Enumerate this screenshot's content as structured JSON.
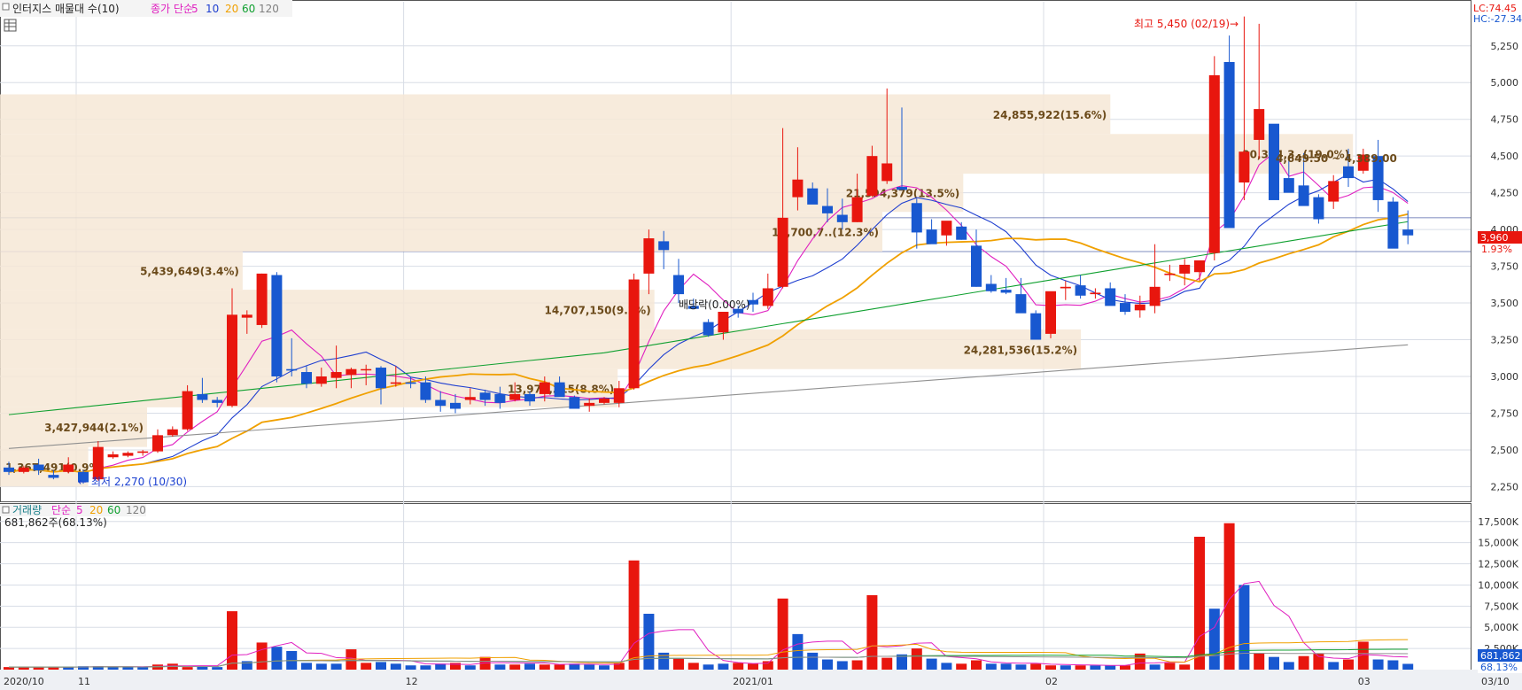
{
  "legend": {
    "title": "인터지스 매물대 수(10)",
    "ma_label": "종가 단순",
    "ma_periods": [
      "5",
      "10",
      "20",
      "60",
      "120"
    ],
    "ma_colors": [
      "#e020c0",
      "#1f3fd0",
      "#f0a000",
      "#10a030",
      "#909090"
    ]
  },
  "top_right": {
    "lc": "LC:74.45",
    "hc": "HC:-27.34"
  },
  "price_tag": {
    "value": "3,960",
    "change": "1.93%"
  },
  "annotations": {
    "high": "최고 5,450 (02/19)",
    "low": "최저 2,270 (10/30)",
    "dividend": "배당락(0.00%)"
  },
  "volume_legend": {
    "title": "거래량",
    "ma_label": "단순",
    "ma_periods": [
      "5",
      "20",
      "60",
      "120"
    ],
    "last": "681,862주(68.13%)"
  },
  "volume_tag": {
    "value": "681,862",
    "pct": "68.13%"
  },
  "colors": {
    "up": "#e8160e",
    "down": "#1858d0",
    "zone": "#f6e8d6",
    "zone_text": "#6b4a1a",
    "axis": "#303030",
    "grid": "#d8dde6"
  },
  "chart_data": {
    "type": "candlestick",
    "y_ticks": [
      2250,
      2500,
      2750,
      3000,
      3250,
      3500,
      3750,
      4000,
      4250,
      4500,
      4750,
      5000,
      5250
    ],
    "ylim": [
      2150,
      5550
    ],
    "x_labels": [
      "2020/10",
      "11",
      "12",
      "2021/01",
      "02",
      "03",
      "03/10"
    ],
    "volume_ticks": [
      "2,500K",
      "5,000K",
      "7,500K",
      "10,000K",
      "12,500K",
      "15,000K",
      "17,500K"
    ],
    "volume_ylim": [
      0,
      18000
    ],
    "volume_profile": [
      {
        "low": 2250,
        "high": 2520,
        "label": "1,367,491(0.9%)",
        "width": 0.06
      },
      {
        "low": 2520,
        "high": 2790,
        "label": "3,427,944(2.1%)",
        "width": 0.1
      },
      {
        "low": 2790,
        "high": 3050,
        "label": "13,979,215(8.8%)",
        "width": 0.42
      },
      {
        "low": 3050,
        "high": 3320,
        "label": "24,281,536(15.2%)",
        "width": 0.735
      },
      {
        "low": 3320,
        "high": 3590,
        "label": "14,707,150(9.2%)",
        "width": 0.445
      },
      {
        "low": 3590,
        "high": 3850,
        "label": "5,439,649(3.4%)",
        "width": 0.165
      },
      {
        "low": 3850,
        "high": 4120,
        "label": "19,700,7..(12.3%)",
        "width": 0.6
      },
      {
        "low": 4120,
        "high": 4380,
        "label": "21,594,379(13.5%)",
        "width": 0.655
      },
      {
        "low": 4380,
        "high": 4650,
        "label": "30,304,3..(19.0%)",
        "width": 0.92
      },
      {
        "low": 4650,
        "high": 4920,
        "label": "24,855,922(15.6%)",
        "width": 0.755
      }
    ],
    "range_label": "4,649.50 ~ 4,389.00",
    "ohlc": [
      [
        2380,
        2420,
        2330,
        2350
      ],
      [
        2350,
        2390,
        2340,
        2380
      ],
      [
        2400,
        2440,
        2330,
        2360
      ],
      [
        2330,
        2360,
        2300,
        2310
      ],
      [
        2350,
        2450,
        2340,
        2400
      ],
      [
        2350,
        2360,
        2270,
        2280
      ],
      [
        2300,
        2560,
        2290,
        2520
      ],
      [
        2450,
        2490,
        2440,
        2470
      ],
      [
        2460,
        2490,
        2450,
        2480
      ],
      [
        2480,
        2500,
        2460,
        2490
      ],
      [
        2490,
        2640,
        2480,
        2600
      ],
      [
        2600,
        2660,
        2590,
        2640
      ],
      [
        2640,
        2940,
        2630,
        2900
      ],
      [
        2880,
        2990,
        2820,
        2840
      ],
      [
        2840,
        2860,
        2790,
        2820
      ],
      [
        2800,
        3600,
        2790,
        3420
      ],
      [
        3400,
        3450,
        3290,
        3420
      ],
      [
        3350,
        3700,
        3330,
        3700
      ],
      [
        3690,
        3710,
        2960,
        3000
      ],
      [
        3050,
        3260,
        3000,
        3040
      ],
      [
        3030,
        3070,
        2920,
        2950
      ],
      [
        2950,
        3060,
        2930,
        3000
      ],
      [
        2990,
        3210,
        2920,
        3030
      ],
      [
        3010,
        3060,
        2920,
        3050
      ],
      [
        3050,
        3080,
        2940,
        3050
      ],
      [
        3060,
        3070,
        2810,
        2920
      ],
      [
        2950,
        3070,
        2930,
        2960
      ],
      [
        2960,
        3000,
        2920,
        2950
      ],
      [
        2960,
        3000,
        2820,
        2840
      ],
      [
        2840,
        2900,
        2760,
        2800
      ],
      [
        2820,
        2880,
        2750,
        2780
      ],
      [
        2840,
        2920,
        2810,
        2860
      ],
      [
        2890,
        2910,
        2800,
        2840
      ],
      [
        2880,
        2930,
        2780,
        2820
      ],
      [
        2840,
        2960,
        2830,
        2880
      ],
      [
        2880,
        2900,
        2800,
        2830
      ],
      [
        2880,
        3000,
        2830,
        2960
      ],
      [
        2960,
        3000,
        2870,
        2860
      ],
      [
        2860,
        2870,
        2780,
        2780
      ],
      [
        2800,
        2850,
        2760,
        2820
      ],
      [
        2820,
        2860,
        2810,
        2850
      ],
      [
        2820,
        2970,
        2790,
        2920
      ],
      [
        2920,
        3700,
        2910,
        3660
      ],
      [
        3700,
        4000,
        3560,
        3940
      ],
      [
        3920,
        3990,
        3730,
        3860
      ],
      [
        3690,
        3800,
        3500,
        3560
      ],
      [
        3480,
        3530,
        3470,
        3460
      ],
      [
        3370,
        3390,
        3270,
        3280
      ],
      [
        3300,
        3380,
        3250,
        3440
      ],
      [
        3460,
        3480,
        3400,
        3430
      ],
      [
        3520,
        3570,
        3440,
        3490
      ],
      [
        3480,
        3700,
        3460,
        3600
      ],
      [
        3610,
        4690,
        3600,
        4080
      ],
      [
        4220,
        4560,
        4130,
        4340
      ],
      [
        4280,
        4320,
        4190,
        4170
      ],
      [
        4160,
        4280,
        4050,
        4110
      ],
      [
        4100,
        4210,
        4000,
        4050
      ],
      [
        4050,
        4380,
        4050,
        4220
      ],
      [
        4230,
        4570,
        4220,
        4500
      ],
      [
        4330,
        4960,
        4310,
        4450
      ],
      [
        4290,
        4830,
        4280,
        4270
      ],
      [
        4180,
        4210,
        3870,
        3980
      ],
      [
        4000,
        4070,
        3930,
        3900
      ],
      [
        3960,
        4050,
        3890,
        4060
      ],
      [
        4020,
        4050,
        3930,
        3930
      ],
      [
        3890,
        4000,
        3610,
        3610
      ],
      [
        3630,
        3690,
        3570,
        3580
      ],
      [
        3590,
        3670,
        3560,
        3570
      ],
      [
        3560,
        3670,
        3550,
        3430
      ],
      [
        3430,
        3450,
        3330,
        3250
      ],
      [
        3290,
        3540,
        3260,
        3580
      ],
      [
        3600,
        3650,
        3520,
        3610
      ],
      [
        3620,
        3690,
        3530,
        3550
      ],
      [
        3560,
        3600,
        3530,
        3570
      ],
      [
        3600,
        3640,
        3520,
        3480
      ],
      [
        3500,
        3560,
        3420,
        3440
      ],
      [
        3450,
        3550,
        3400,
        3490
      ],
      [
        3480,
        3900,
        3430,
        3610
      ],
      [
        3690,
        3760,
        3650,
        3700
      ],
      [
        3700,
        3800,
        3620,
        3760
      ],
      [
        3710,
        3760,
        3650,
        3790
      ],
      [
        3840,
        5180,
        3790,
        5050
      ],
      [
        5140,
        5320,
        4120,
        4010
      ],
      [
        4320,
        5450,
        4200,
        4530
      ],
      [
        4610,
        5400,
        4480,
        4820
      ],
      [
        4720,
        4700,
        4290,
        4200
      ],
      [
        4350,
        4480,
        4260,
        4250
      ],
      [
        4300,
        4520,
        4170,
        4160
      ],
      [
        4220,
        4240,
        4040,
        4070
      ],
      [
        4190,
        4370,
        4140,
        4330
      ],
      [
        4430,
        4550,
        4290,
        4350
      ],
      [
        4400,
        4550,
        4380,
        4510
      ],
      [
        4500,
        4610,
        4120,
        4200
      ],
      [
        4190,
        4220,
        3950,
        3870
      ],
      [
        4000,
        4130,
        3900,
        3960
      ]
    ],
    "volume": [
      [
        300,
        1
      ],
      [
        300,
        1
      ],
      [
        300,
        1
      ],
      [
        300,
        1
      ],
      [
        300,
        0
      ],
      [
        400,
        0
      ],
      [
        400,
        0
      ],
      [
        300,
        0
      ],
      [
        300,
        0
      ],
      [
        300,
        0
      ],
      [
        600,
        1
      ],
      [
        700,
        1
      ],
      [
        300,
        1
      ],
      [
        400,
        0
      ],
      [
        300,
        0
      ],
      [
        6900,
        1
      ],
      [
        1000,
        0
      ],
      [
        3200,
        1
      ],
      [
        2700,
        0
      ],
      [
        2200,
        0
      ],
      [
        800,
        0
      ],
      [
        700,
        0
      ],
      [
        700,
        0
      ],
      [
        2400,
        1
      ],
      [
        800,
        1
      ],
      [
        900,
        0
      ],
      [
        700,
        0
      ],
      [
        500,
        0
      ],
      [
        500,
        0
      ],
      [
        700,
        0
      ],
      [
        800,
        1
      ],
      [
        500,
        0
      ],
      [
        1500,
        1
      ],
      [
        600,
        0
      ],
      [
        600,
        1
      ],
      [
        700,
        0
      ],
      [
        600,
        1
      ],
      [
        600,
        1
      ],
      [
        700,
        0
      ],
      [
        600,
        0
      ],
      [
        500,
        0
      ],
      [
        800,
        1
      ],
      [
        12900,
        1
      ],
      [
        6600,
        0
      ],
      [
        2000,
        0
      ],
      [
        1300,
        1
      ],
      [
        800,
        1
      ],
      [
        600,
        0
      ],
      [
        700,
        0
      ],
      [
        800,
        1
      ],
      [
        700,
        1
      ],
      [
        1000,
        1
      ],
      [
        8400,
        1
      ],
      [
        4200,
        0
      ],
      [
        2000,
        0
      ],
      [
        1200,
        0
      ],
      [
        1000,
        0
      ],
      [
        1100,
        1
      ],
      [
        8800,
        1
      ],
      [
        1400,
        1
      ],
      [
        1800,
        0
      ],
      [
        2500,
        1
      ],
      [
        1300,
        0
      ],
      [
        800,
        0
      ],
      [
        700,
        1
      ],
      [
        1100,
        1
      ],
      [
        700,
        0
      ],
      [
        700,
        0
      ],
      [
        600,
        0
      ],
      [
        700,
        1
      ],
      [
        500,
        1
      ],
      [
        500,
        0
      ],
      [
        500,
        1
      ],
      [
        500,
        0
      ],
      [
        500,
        0
      ],
      [
        500,
        1
      ],
      [
        1900,
        1
      ],
      [
        600,
        0
      ],
      [
        800,
        1
      ],
      [
        600,
        1
      ],
      [
        15700,
        1
      ],
      [
        7200,
        0
      ],
      [
        17300,
        1
      ],
      [
        10000,
        0
      ],
      [
        1900,
        1
      ],
      [
        1500,
        0
      ],
      [
        900,
        0
      ],
      [
        1600,
        1
      ],
      [
        1900,
        1
      ],
      [
        900,
        0
      ],
      [
        1200,
        1
      ],
      [
        3300,
        1
      ],
      [
        1200,
        0
      ],
      [
        1100,
        0
      ],
      [
        682,
        0
      ]
    ]
  }
}
